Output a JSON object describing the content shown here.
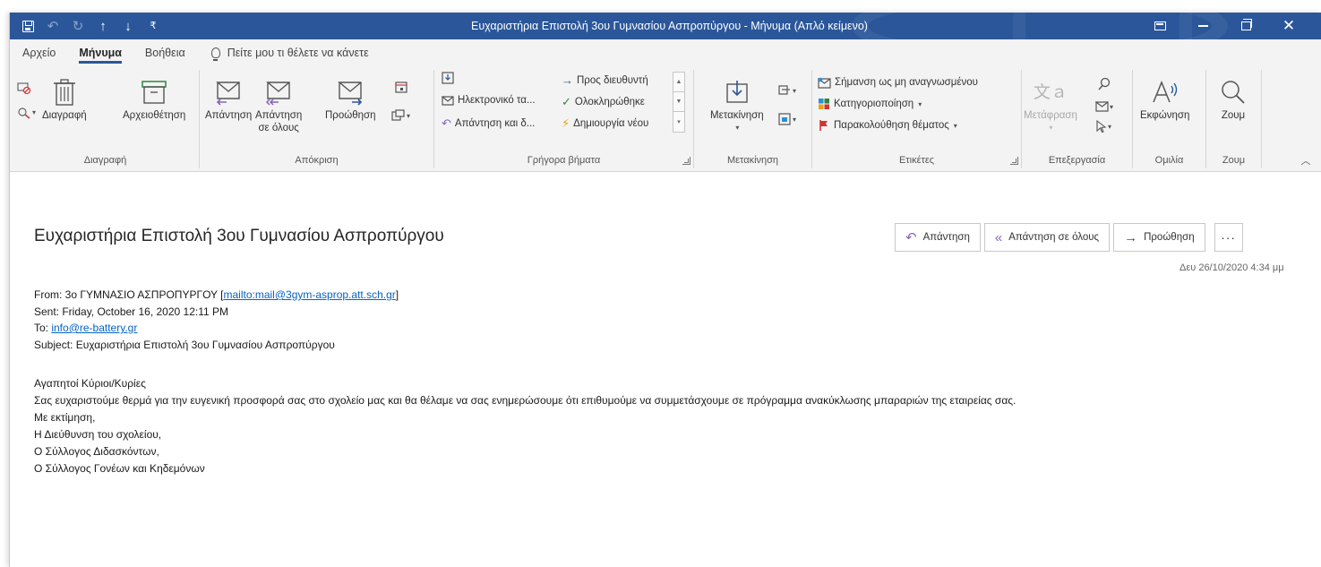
{
  "window": {
    "title": "Ευχαριστήρια Επιστολή 3ου Γυμνασίου Ασπροπύργου  -  Μήνυμα (Απλό κείμενο)"
  },
  "quick_access": [
    "save-icon",
    "undo-icon",
    "redo-icon",
    "arrow-up-icon",
    "arrow-down-icon",
    "customize-icon"
  ],
  "tabs": [
    {
      "label": "Αρχείο",
      "active": false
    },
    {
      "label": "Μήνυμα",
      "active": true
    },
    {
      "label": "Βοήθεια",
      "active": false
    }
  ],
  "tell_me": "Πείτε μου τι θέλετε να κάνετε",
  "ribbon": {
    "delete_group": {
      "label": "Διαγραφή",
      "delete": "Διαγραφή",
      "archive": "Αρχειοθέτηση"
    },
    "respond_group": {
      "label": "Απόκριση",
      "reply": "Απάντηση",
      "reply_all_1": "Απάντηση",
      "reply_all_2": "σε όλους",
      "forward": "Προώθηση"
    },
    "quick_steps": {
      "label": "Γρήγορα βήματα",
      "items": [
        "Προς διευθυντή",
        "Ηλεκτρονικό τα...",
        "Ολοκληρώθηκε",
        "Απάντηση και δ...",
        "Δημιουργία νέου"
      ]
    },
    "move_group": {
      "label": "Μετακίνηση",
      "move": "Μετακίνηση"
    },
    "tags_group": {
      "label": "Ετικέτες",
      "mark_unread": "Σήμανση ως μη αναγνωσμένου",
      "categorize": "Κατηγοριοποίηση",
      "follow_up": "Παρακολούθηση θέματος"
    },
    "editing_group": {
      "label": "Επεξεργασία",
      "translate": "Μετάφραση"
    },
    "speech_group": {
      "label": "Ομιλία",
      "read_aloud": "Εκφώνηση"
    },
    "zoom_group": {
      "label": "Ζουμ",
      "zoom": "Ζουμ"
    }
  },
  "message": {
    "subject": "Ευχαριστήρια Επιστολή 3ου Γυμνασίου Ασπροπύργου",
    "actions": {
      "reply": "Απάντηση",
      "reply_all": "Απάντηση σε όλους",
      "forward": "Προώθηση",
      "more": "···"
    },
    "date": "Δευ 26/10/2020 4:34 μμ",
    "header": {
      "from_prefix": "From: 3ο ΓΥΜΝΑΣΙΟ ΑΣΠΡΟΠΥΡΓΟΥ [",
      "from_link": "mailto:mail@3gym-asprop.att.sch.gr",
      "from_suffix": "]",
      "sent": "Sent: Friday, October 16, 2020 12:11 PM",
      "to_prefix": "To: ",
      "to_link": "info@re-battery.gr",
      "subject": "Subject: Ευχαριστήρια Επιστολή 3ου Γυμνασίου Ασπροπύργου"
    },
    "body": [
      "Αγαπητοί Κύριοι/Κυρίες",
      "Σας ευχαριστούμε θερμά για την ευγενική προσφορά σας στο σχολείο μας και θα θέλαμε να σας ενημερώσουμε ότι επιθυμούμε να συμμετάσχουμε σε πρόγραμμα ανακύκλωσης μπαραριών της εταιρείας σας.",
      "Με εκτίμηση,",
      "Η Διεύθυνση του σχολείου,",
      "Ο Σύλλογος Διδασκόντων,",
      "Ο Σύλλογος Γονέων και Κηδεμόνων"
    ]
  },
  "colors": {
    "titlebar": "#2b579a",
    "ribbon_bg": "#f3f3f3",
    "link": "#0563c1"
  }
}
